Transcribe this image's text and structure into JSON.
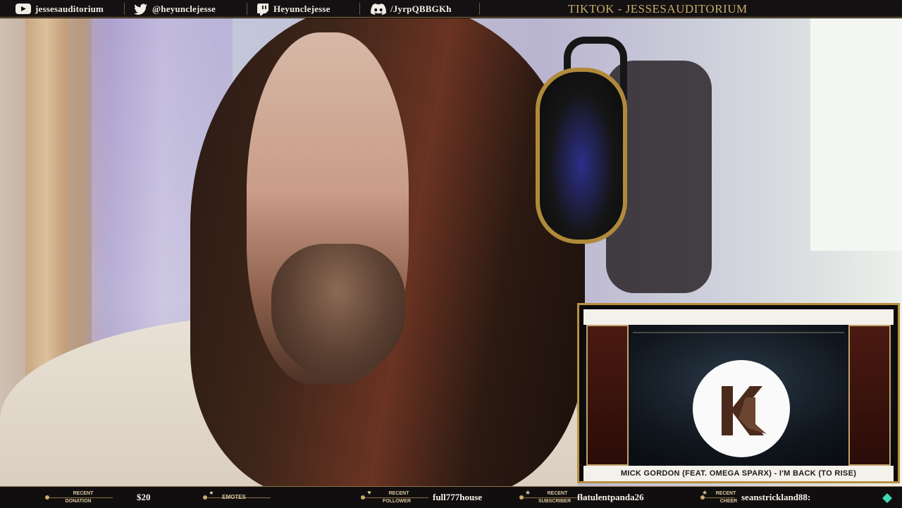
{
  "socials": [
    {
      "platform": "youtube",
      "icon": "youtube-icon",
      "handle": "jessesauditorium"
    },
    {
      "platform": "twitter",
      "icon": "twitter-icon",
      "handle": "@heyunclejesse"
    },
    {
      "platform": "twitch",
      "icon": "twitch-icon",
      "handle": "Heyunclejesse"
    },
    {
      "platform": "discord",
      "icon": "discord-icon",
      "handle": "/JyrpQBBGKh"
    }
  ],
  "tiktok_label": "TIKTOK - JESSESAUDITORIUM",
  "player": {
    "caption": "MICK GORDON (FEAT. OMEGA SPARX) - I'M BACK (TO RISE)"
  },
  "stats": [
    {
      "label_top": "RECENT",
      "label_bottom": "DONATION",
      "value": "$20",
      "icon": "donation-icon"
    },
    {
      "label_top": "",
      "label_bottom": "EMOTES",
      "value": "",
      "icon": "money-bag-icon"
    },
    {
      "label_top": "RECENT",
      "label_bottom": "FOLLOWER",
      "value": "full777house",
      "icon": "heart-icon"
    },
    {
      "label_top": "RECENT",
      "label_bottom": "SUBSCRIBER",
      "value": "flatulentpanda26",
      "icon": "trophy-icon"
    },
    {
      "label_top": "RECENT",
      "label_bottom": "CHEER",
      "value": "seanstrickland88:",
      "icon": "star-icon"
    }
  ],
  "colors": {
    "gold": "#c9ad6a",
    "bar_bg": "#141112",
    "text_light": "#f1ece4"
  }
}
